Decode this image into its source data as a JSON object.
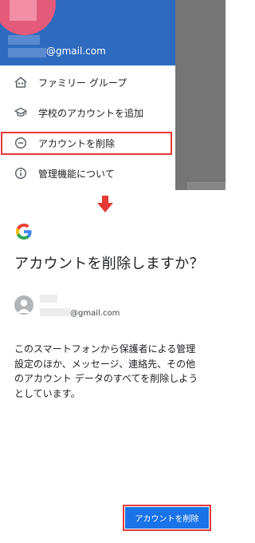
{
  "drawer": {
    "account_email": "@gmail.com",
    "menu": [
      {
        "label": "ファミリー グループ",
        "icon": "family-home-icon"
      },
      {
        "label": "学校のアカウントを追加",
        "icon": "school-cap-icon"
      },
      {
        "label": "アカウントを削除",
        "icon": "remove-circle-icon"
      },
      {
        "label": "管理機能について",
        "icon": "info-icon"
      }
    ]
  },
  "dialog": {
    "title": "アカウントを削除しますか？",
    "account_email": "@gmail.com",
    "description_lines": [
      "このスマートフォンから保護者による管理",
      "設定のほか、メッセージ、連絡先、その他",
      "のアカウント データのすべてを削除しよう",
      "としています。"
    ],
    "remove_button": "アカウントを削除"
  },
  "colors": {
    "header_blue": "#2e6bbf",
    "accent_blue": "#1a73e8",
    "highlight_red": "#e53935"
  }
}
